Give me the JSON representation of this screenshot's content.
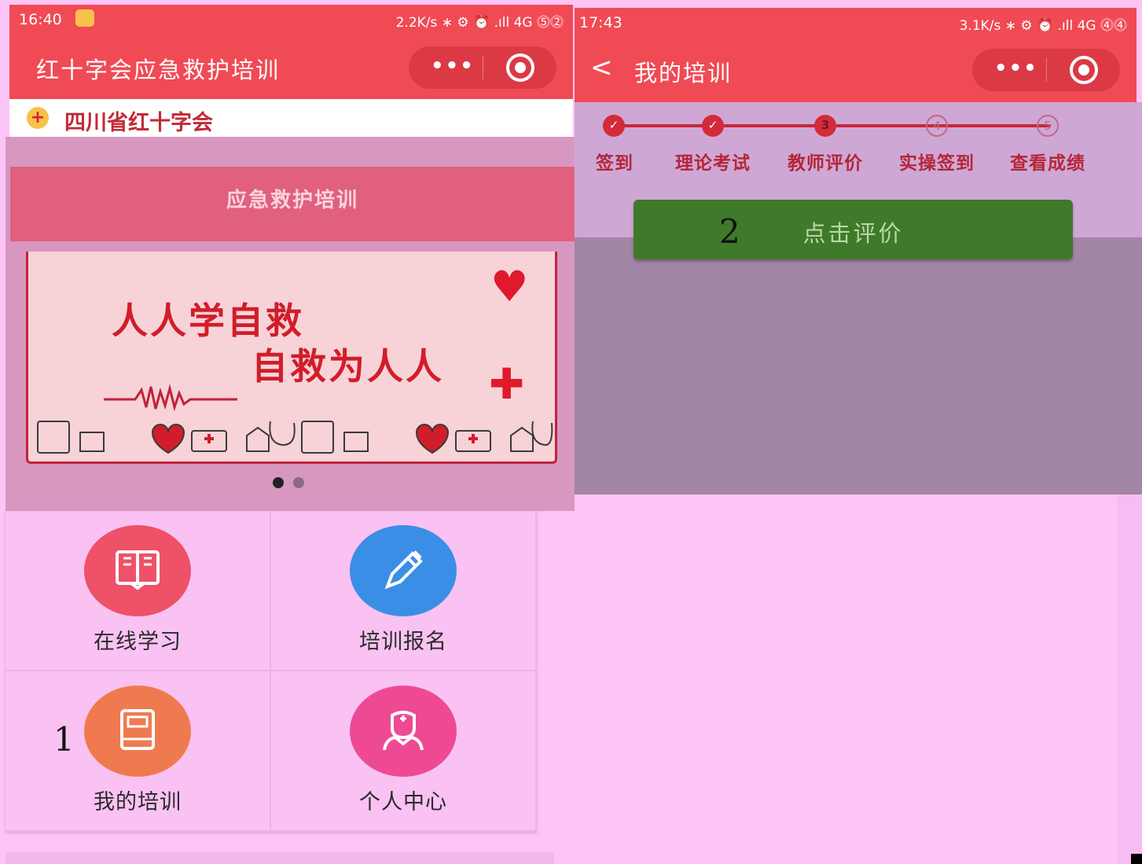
{
  "left_screen": {
    "status_bar": {
      "time": "16:40",
      "indicators": "2.2K/s ∗ ⚙ ⏰ .ıll 4G ⓹⓶"
    },
    "title_bar": {
      "title": "红十字会应急救护培训",
      "more_icon": "•••",
      "target_icon": "target-icon"
    },
    "org": {
      "name": "四川省红十字会"
    },
    "banner": {
      "heading": "应急救护培训",
      "slogan_line1": "人人学自救",
      "slogan_line2": "自救为人人",
      "carousel_dots": 2,
      "active_dot": 0
    },
    "menu": [
      {
        "label": "在线学习",
        "icon": "book-open-icon",
        "color": "#ee5168"
      },
      {
        "label": "培训报名",
        "icon": "pen-icon",
        "color": "#3b8ee6"
      },
      {
        "label": "我的培训",
        "icon": "notebook-icon",
        "color": "#f07a50"
      },
      {
        "label": "个人中心",
        "icon": "nurse-icon",
        "color": "#ee4a94"
      }
    ],
    "annotation": "1"
  },
  "right_screen": {
    "status_bar": {
      "time": "17:43",
      "indicators": "3.1K/s ∗ ⚙ ⏰ .ıll 4G ⓸⓸"
    },
    "title_bar": {
      "back_icon": "<",
      "title": "我的培训",
      "more_icon": "•••"
    },
    "steps": [
      {
        "number": "1",
        "label": "签到",
        "state": "done"
      },
      {
        "number": "2",
        "label": "理论考试",
        "state": "done"
      },
      {
        "number": "3",
        "label": "教师评价",
        "state": "current"
      },
      {
        "number": "4",
        "label": "实操签到",
        "state": "todo"
      },
      {
        "number": "5",
        "label": "查看成绩",
        "state": "todo"
      }
    ],
    "evaluate_button": "点击评价",
    "annotation": "2"
  },
  "colors": {
    "header_red": "#f04a55",
    "button_green": "#3f7a2a",
    "overlay_pink": "#fcc4f7"
  }
}
